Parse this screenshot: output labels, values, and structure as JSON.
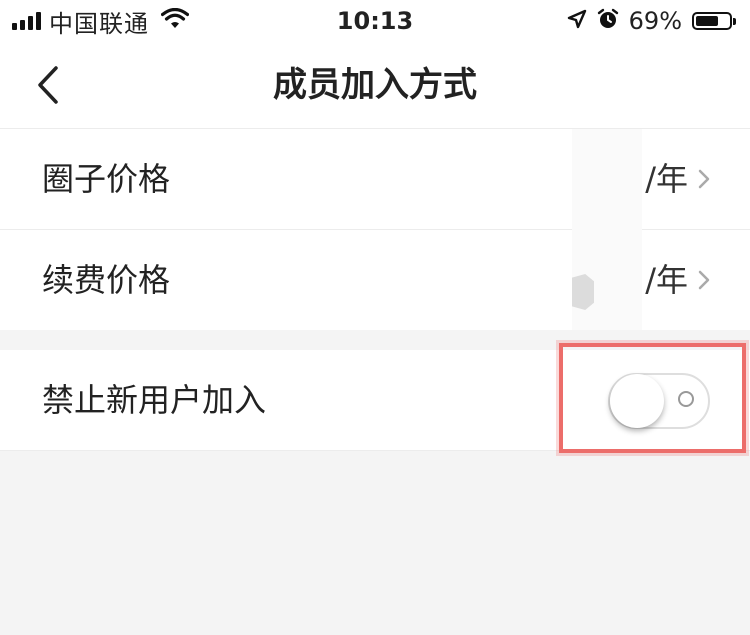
{
  "status_bar": {
    "carrier": "中国联通",
    "time": "10:13",
    "battery_percent": "69%",
    "battery_level": 0.69,
    "icons": [
      "signal-icon",
      "wifi-icon",
      "location-arrow-icon",
      "alarm-icon",
      "battery-icon"
    ]
  },
  "nav": {
    "title": "成员加入方式",
    "back_icon": "chevron-left-icon"
  },
  "settings": {
    "rows": [
      {
        "label": "圈子价格",
        "value": "/年"
      },
      {
        "label": "续费价格",
        "value": "/年"
      }
    ],
    "toggle_row": {
      "label": "禁止新用户加入",
      "enabled": false
    }
  },
  "colors": {
    "background": "#f4f4f4",
    "highlight": "#ec6d6a"
  }
}
